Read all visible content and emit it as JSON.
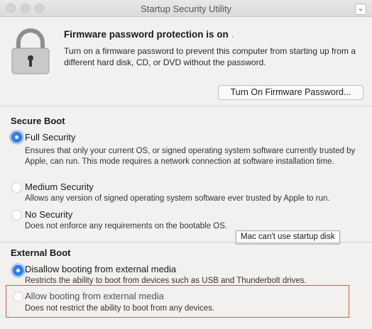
{
  "window": {
    "title": "Startup Security Utility"
  },
  "firmware": {
    "heading": "Firmware password protection is on",
    "heading_suffix": ".",
    "description": "Turn on a firmware password to prevent this computer from starting up from a different hard disk, CD, or DVD without the password.",
    "button_label": "Turn On Firmware Password..."
  },
  "secure_boot": {
    "title": "Secure Boot",
    "options": [
      {
        "label": "Full Security",
        "description": "Ensures that only your current OS, or signed operating system software currently trusted by Apple, can run. This mode requires a network connection at software installation time.",
        "selected": true
      },
      {
        "label": "Medium Security",
        "description": "Allows any version of signed operating system software ever trusted by Apple to run.",
        "selected": false
      },
      {
        "label": "No Security",
        "description": "Does not enforce any requirements on the bootable OS.",
        "selected": false
      }
    ]
  },
  "tooltip": {
    "text": "Mac can't use startup disk"
  },
  "external_boot": {
    "title": "External Boot",
    "options": [
      {
        "label": "Disallow booting from external media",
        "description": "Restricts the ability to boot from devices such as USB and Thunderbolt drives.",
        "selected": true
      },
      {
        "label": "Allow booting from external media",
        "description": "Does not restrict the ability to boot from any devices.",
        "selected": false
      }
    ]
  },
  "colors": {
    "accent": "#2f7ff0",
    "highlight_border": "#e0524c"
  },
  "icons": {
    "lock": "lock-icon",
    "dropdown": "chevron-down-icon"
  }
}
